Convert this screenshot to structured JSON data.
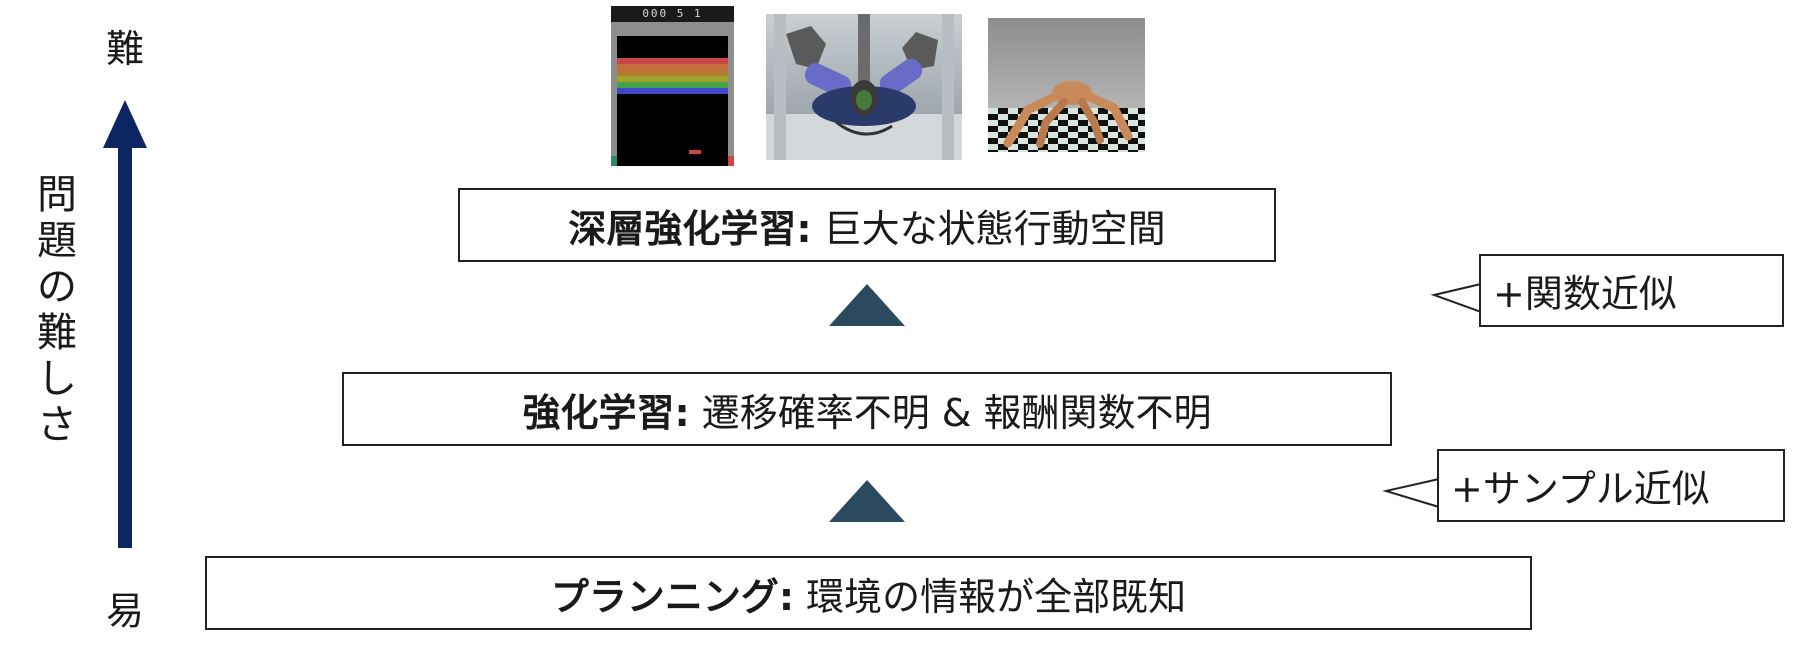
{
  "axis": {
    "top_label": "難",
    "bottom_label": "易",
    "title_chars": [
      "問",
      "題",
      "の",
      "難",
      "し",
      "さ"
    ],
    "color": "#0c2664"
  },
  "levels": [
    {
      "id": "deep-rl",
      "title": "深層強化学習:",
      "desc": "巨大な状態行動空間"
    },
    {
      "id": "rl",
      "title": "強化学習:",
      "desc": "遷移確率不明 & 報酬関数不明"
    },
    {
      "id": "planning",
      "title": "プランニング:",
      "desc": "環境の情報が全部既知"
    }
  ],
  "callouts": {
    "function_approx": "+関数近似",
    "sample_approx": "+サンプル近似"
  },
  "images": {
    "breakout": {
      "score": "000 5 1",
      "icon": "breakout-game-image"
    },
    "robot": {
      "icon": "robot-hands-image"
    },
    "ant": {
      "icon": "ant-robot-simulation-image"
    }
  },
  "colors": {
    "arrow": "#0c2664",
    "triangle": "#2c4a5e",
    "border": "#222222"
  }
}
